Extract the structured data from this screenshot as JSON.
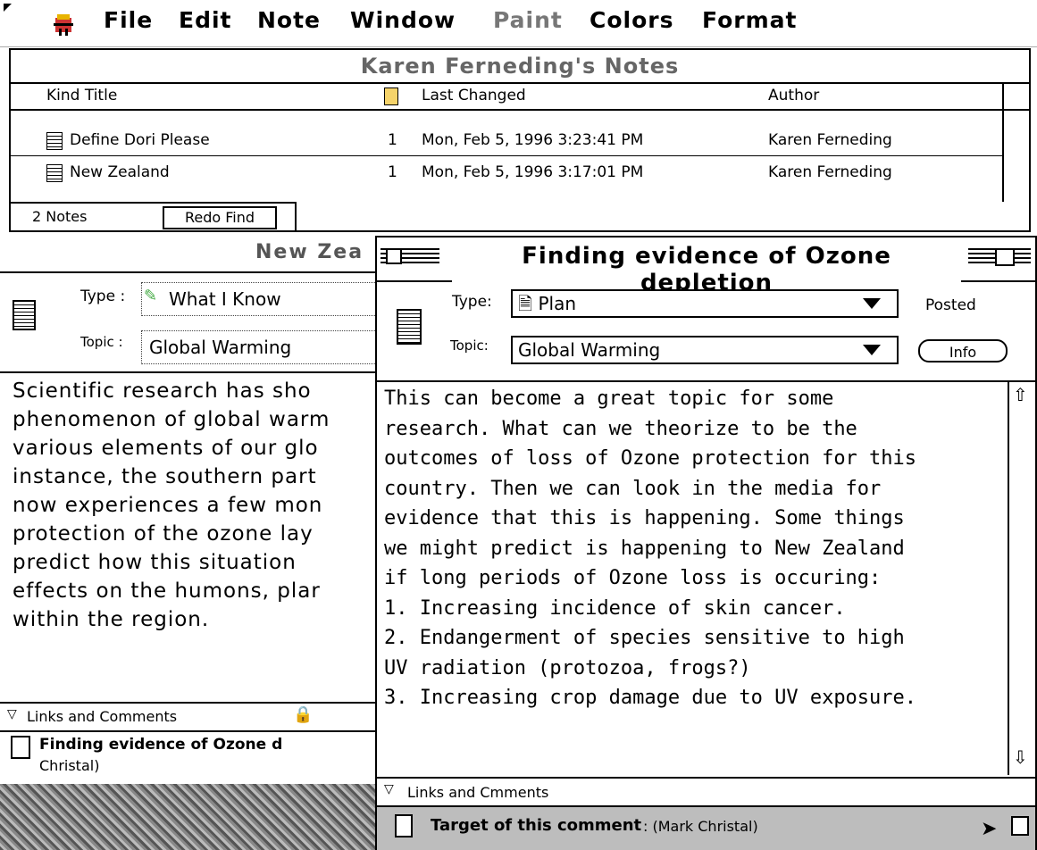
{
  "menubar": {
    "items": [
      "File",
      "Edit",
      "Note",
      "Window",
      "Paint",
      "Colors",
      "Format"
    ]
  },
  "notes_list": {
    "title": "Karen Ferneding's Notes",
    "columns": {
      "kind_title": "Kind Title",
      "last_changed": "Last Changed",
      "author": "Author"
    },
    "rows": [
      {
        "title": "Define Dori Please",
        "count": "1",
        "last_changed": "Mon, Feb 5, 1996 3:23:41 PM",
        "author": "Karen Ferneding"
      },
      {
        "title": "New Zealand",
        "count": "1",
        "last_changed": "Mon, Feb 5, 1996 3:17:01 PM",
        "author": "Karen Ferneding"
      }
    ],
    "status": "2 Notes",
    "redo_label": "Redo Find"
  },
  "left_note": {
    "title": "New Zea",
    "type_label": "Type :",
    "type_value": "What I Know",
    "topic_label": "Topic :",
    "topic_value": "Global Warming",
    "body": "Scientific research has sho\nphenomenon of global warm\nvarious elements of our glo\ninstance, the southern part\nnow experiences a few mon\nprotection of the ozone lay\npredict how this situation \neffects on the humons, plar\nwithin the region.",
    "links_label": "Links and Comments",
    "link_item_title": "Finding evidence of Ozone d",
    "link_item_author": "Christal)"
  },
  "front_note": {
    "title": "Finding evidence of Ozone depletion",
    "type_label": "Type:",
    "type_value": "Plan",
    "topic_label": "Topic:",
    "topic_value": "Global Warming",
    "posted": "Posted",
    "info_label": "Info",
    "body": "This can become a great topic for some\nresearch. What can we theorize to be the\noutcomes of loss of Ozone protection for this\ncountry. Then we can look in the media for\nevidence that this is happening. Some things\nwe might predict is happening to New Zealand\nif long periods of Ozone loss is occuring:\n1. Increasing incidence of skin cancer.\n2. Endangerment of species sensitive to high\nUV radiation (protozoa, frogs?)\n3. Increasing crop damage due to UV exposure.",
    "links_label": "Links and Cmments",
    "target_label": "Target of this comment",
    "target_author": ": (Mark Christal)"
  }
}
